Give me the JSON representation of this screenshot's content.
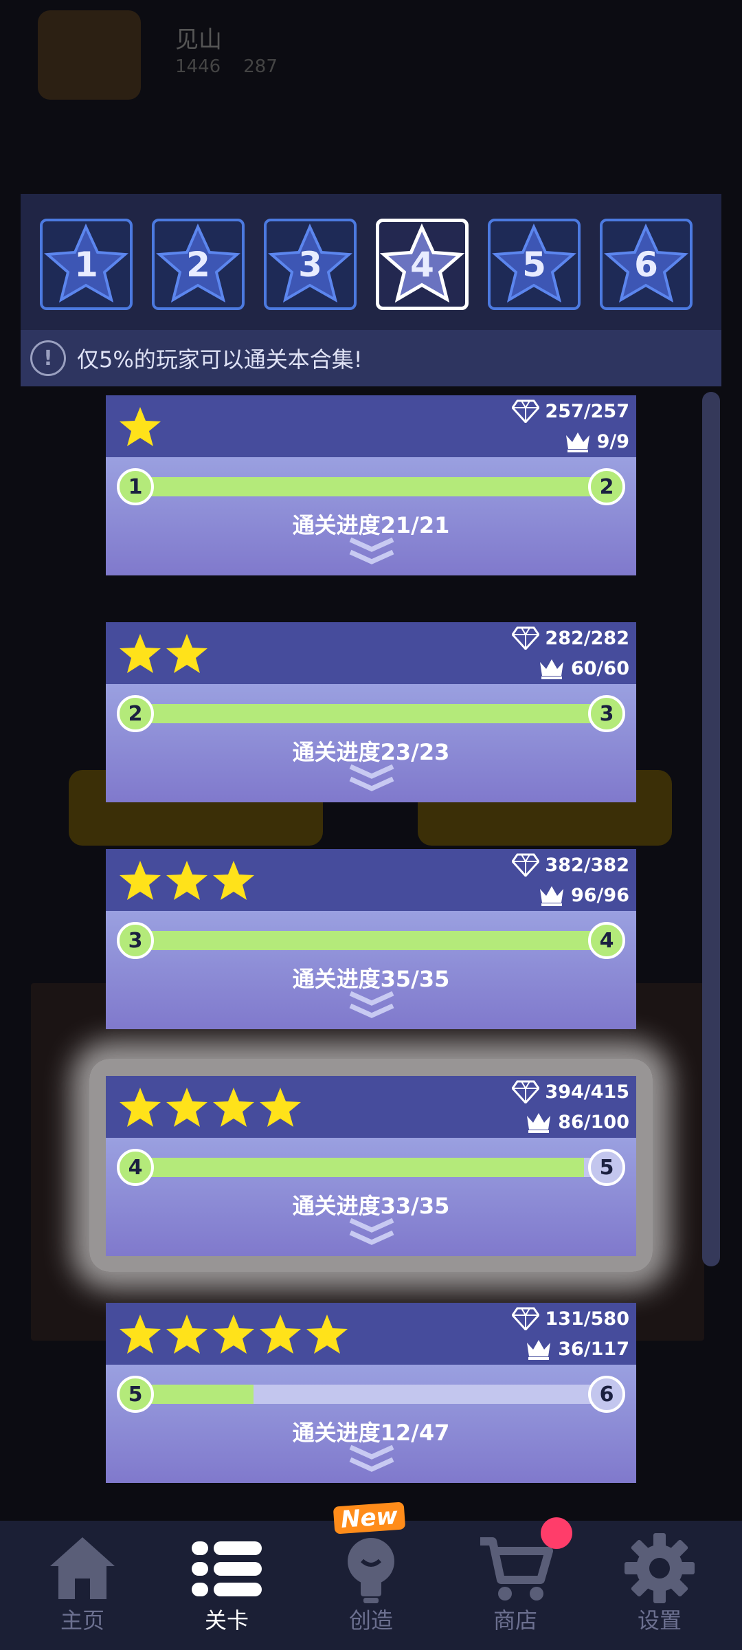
{
  "background": {
    "player_name": "见山",
    "gems": "1446",
    "crowns": "287"
  },
  "collection_tabs": [
    {
      "number": "1",
      "selected": false
    },
    {
      "number": "2",
      "selected": false
    },
    {
      "number": "3",
      "selected": false
    },
    {
      "number": "4",
      "selected": true
    },
    {
      "number": "5",
      "selected": false
    },
    {
      "number": "6",
      "selected": false
    }
  ],
  "notice": {
    "text": "仅5%的玩家可以通关本合集!"
  },
  "levels": [
    {
      "stars": 1,
      "gems": "257/257",
      "crowns": "9/9",
      "from": "1",
      "to": "2",
      "progress_text": "通关进度21/21",
      "progress": 1.0
    },
    {
      "stars": 2,
      "gems": "282/282",
      "crowns": "60/60",
      "from": "2",
      "to": "3",
      "progress_text": "通关进度23/23",
      "progress": 1.0
    },
    {
      "stars": 3,
      "gems": "382/382",
      "crowns": "96/96",
      "from": "3",
      "to": "4",
      "progress_text": "通关进度35/35",
      "progress": 1.0
    },
    {
      "stars": 4,
      "gems": "394/415",
      "crowns": "86/100",
      "from": "4",
      "to": "5",
      "progress_text": "通关进度33/35",
      "progress": 0.943
    },
    {
      "stars": 5,
      "gems": "131/580",
      "crowns": "36/117",
      "from": "5",
      "to": "6",
      "progress_text": "通关进度12/47",
      "progress": 0.255
    }
  ],
  "nav": {
    "home": "主页",
    "levels": "关卡",
    "create": "创造",
    "shop": "商店",
    "settings": "设置",
    "new_badge": "New"
  },
  "colors": {
    "accent_green": "#b4ea7a",
    "star_yellow": "#ffe21a",
    "card_header": "#464c9c",
    "tab_border": "#4c7ae0"
  }
}
